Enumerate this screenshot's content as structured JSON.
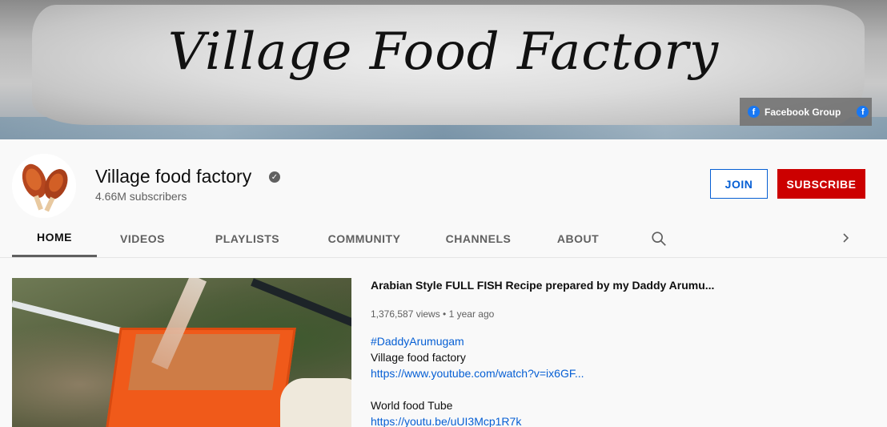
{
  "banner": {
    "title": "Village Food Factory",
    "link_label": "Facebook Group"
  },
  "channel": {
    "name": "Village food factory",
    "subscribers": "4.66M subscribers",
    "join_label": "JOIN",
    "subscribe_label": "SUBSCRIBE"
  },
  "tabs": [
    {
      "label": "HOME"
    },
    {
      "label": "VIDEOS"
    },
    {
      "label": "PLAYLISTS"
    },
    {
      "label": "COMMUNITY"
    },
    {
      "label": "CHANNELS"
    },
    {
      "label": "ABOUT"
    }
  ],
  "featured": {
    "title": "Arabian Style FULL FISH Recipe prepared by my Daddy Arumu...",
    "meta": "1,376,587 views • 1 year ago",
    "description": [
      {
        "text": "#DaddyArumugam",
        "link": true
      },
      {
        "text": "Village food factory",
        "link": false
      },
      {
        "text": "https://www.youtube.com/watch?v=ix6GF...",
        "link": true
      },
      {
        "text": "",
        "link": false
      },
      {
        "text": "World food Tube",
        "link": false
      },
      {
        "text": "https://youtu.be/uUI3Mcp1R7k",
        "link": true
      }
    ]
  },
  "colors": {
    "subscribe": "#cc0000",
    "link": "#065fd4",
    "facebook": "#1877f2"
  }
}
